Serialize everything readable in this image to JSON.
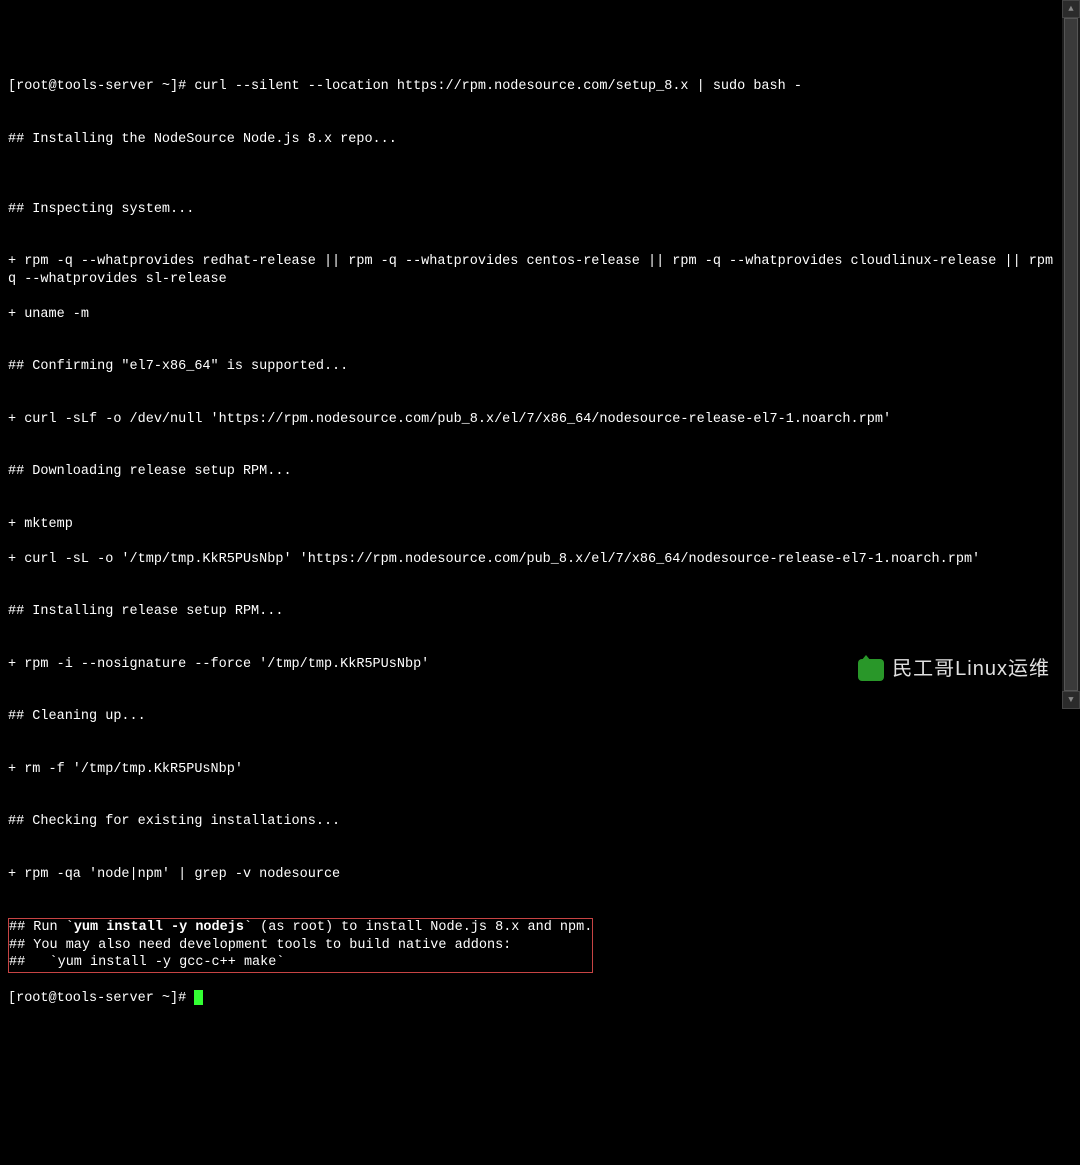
{
  "terminal": {
    "prompt1_part1": "[root@tools-server ~]# ",
    "cmd1": "curl --silent --location https://rpm.nodesource.com/setup_8.x | sudo bash -",
    "blank": "",
    "h_install": "## Installing the NodeSource Node.js 8.x repo...",
    "h_inspect": "## Inspecting system...",
    "l_rpm_provides": "+ rpm -q --whatprovides redhat-release || rpm -q --whatprovides centos-release || rpm -q --whatprovides cloudlinux-release || rpm -q --whatprovides sl-release",
    "l_uname": "+ uname -m",
    "h_confirm": "## Confirming \"el7-x86_64\" is supported...",
    "l_curl_pub": "+ curl -sLf -o /dev/null 'https://rpm.nodesource.com/pub_8.x/el/7/x86_64/nodesource-release-el7-1.noarch.rpm'",
    "h_download": "## Downloading release setup RPM...",
    "l_mktemp": "+ mktemp",
    "l_curl_tmp": "+ curl -sL -o '/tmp/tmp.KkR5PUsNbp' 'https://rpm.nodesource.com/pub_8.x/el/7/x86_64/nodesource-release-el7-1.noarch.rpm'",
    "h_installrpm": "## Installing release setup RPM...",
    "l_rpm_i": "+ rpm -i --nosignature --force '/tmp/tmp.KkR5PUsNbp'",
    "h_clean": "## Cleaning up...",
    "l_rm": "+ rm -f '/tmp/tmp.KkR5PUsNbp'",
    "h_check": "## Checking for existing installations...",
    "l_rpm_qa": "+ rpm -qa 'node|npm' | grep -v nodesource",
    "box1_pre": "## Run `",
    "box1_cmd": "yum install -y nodejs",
    "box1_post": "` (as root) to install Node.js 8.x and npm.",
    "box2": "## You may also need development tools to build native addons:",
    "box3": "##   `yum install -y gcc-c++ make`",
    "prompt2": "[root@tools-server ~]# "
  },
  "watermark": "民工哥Linux运维"
}
